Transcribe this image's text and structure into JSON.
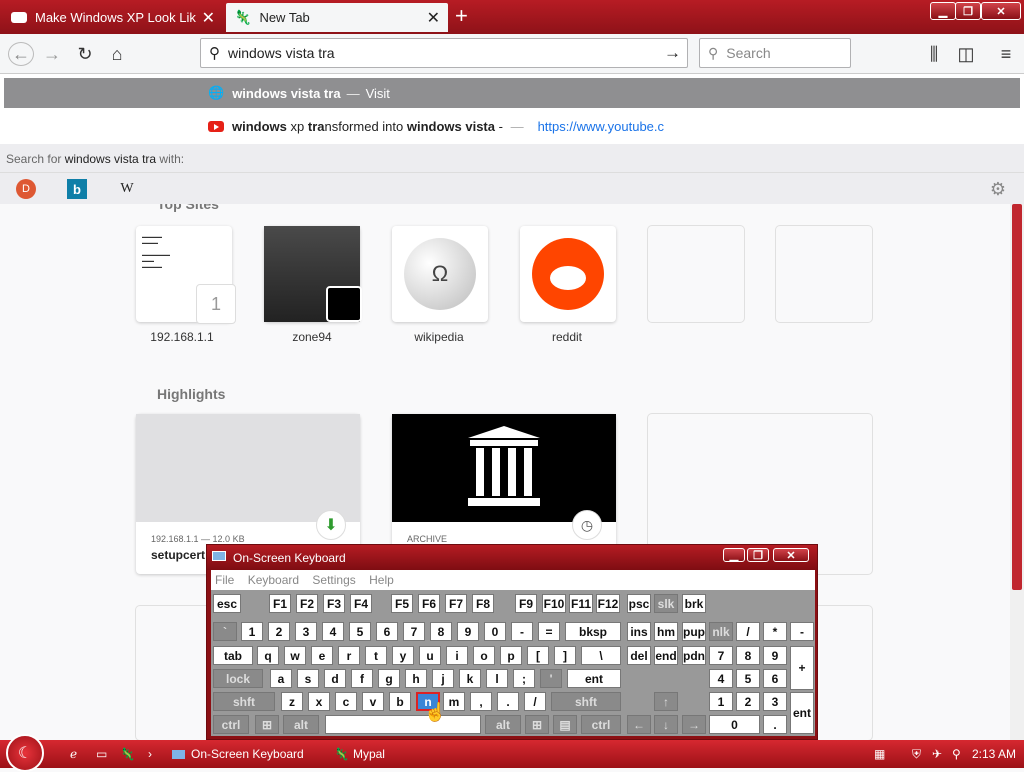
{
  "tabs": [
    {
      "title": "Make Windows XP Look Like W"
    },
    {
      "title": "New Tab"
    }
  ],
  "window": {
    "minimize": "▁",
    "maximize": "❐",
    "close": "✕"
  },
  "url": {
    "value": "windows vista tra"
  },
  "search": {
    "placeholder": "Search"
  },
  "suggestions": {
    "primary": {
      "text": "windows vista tra",
      "action": "Visit"
    },
    "secondary": {
      "pre": "windows",
      "b1": " xp ",
      "mid": "tra",
      "b2": "nsformed into ",
      "bold2": "windows vista",
      "post": " - ",
      "url": "https://www.youtube.c"
    }
  },
  "search_with": {
    "label": "Search for",
    "query": "windows vista tra",
    "suffix": "with:"
  },
  "content": {
    "top_sites_heading": "Top Sites",
    "sites": [
      {
        "label": "192.168.1.1"
      },
      {
        "label": "zone94"
      },
      {
        "label": "wikipedia"
      },
      {
        "label": "reddit"
      }
    ],
    "highlights_heading": "Highlights",
    "highlight1": {
      "meta": "192.168.1.1 — 12.0 KB",
      "title": "setupcert"
    },
    "highlight2": {
      "meta": "ARCHIVE"
    }
  },
  "osk": {
    "title": "On-Screen Keyboard",
    "menu": [
      "File",
      "Keyboard",
      "Settings",
      "Help"
    ]
  },
  "taskbar": {
    "items": [
      "On-Screen Keyboard",
      "Mypal"
    ],
    "time": "2:13 AM"
  }
}
